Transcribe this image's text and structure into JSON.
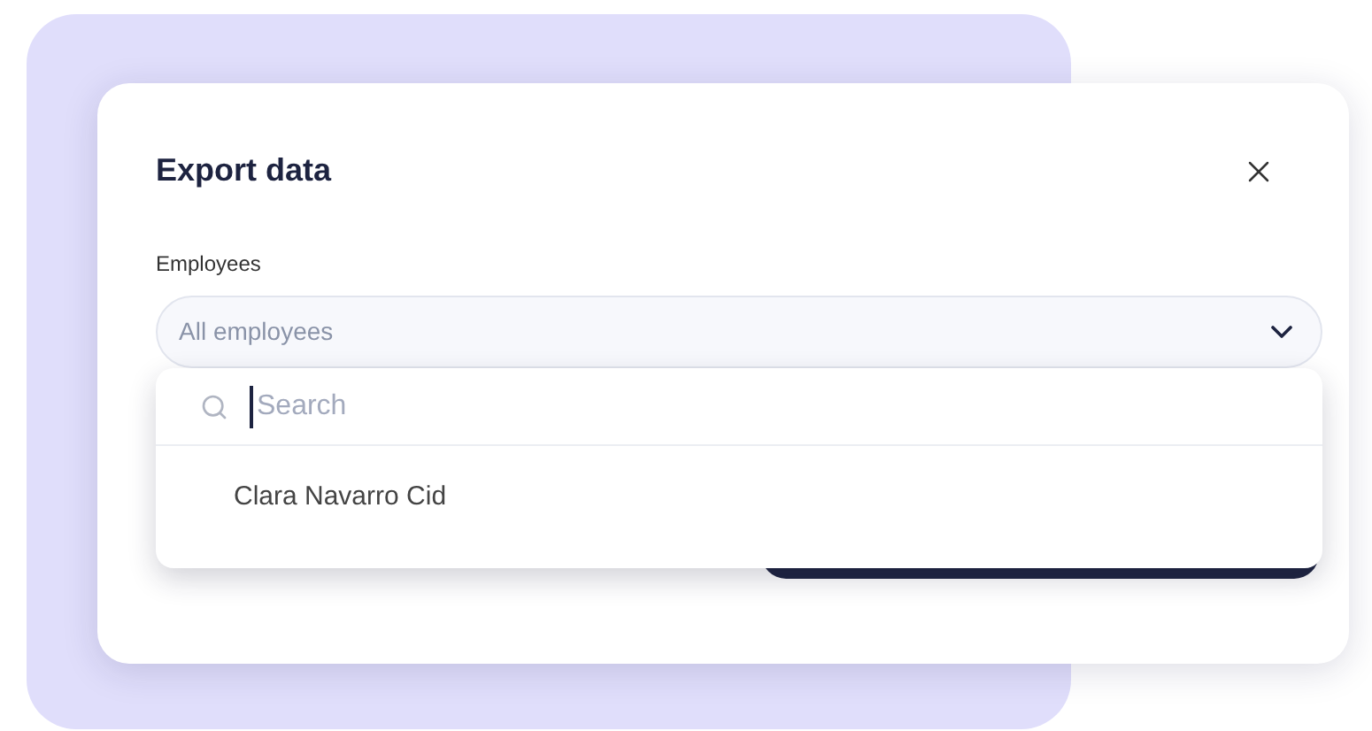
{
  "dialog": {
    "title": "Export data",
    "field": {
      "label": "Employees",
      "value": "All employees",
      "expanded": true
    },
    "dropdown": {
      "search": {
        "placeholder": "Search"
      },
      "options": [
        {
          "label": "Clara Navarro Cid"
        }
      ]
    }
  }
}
